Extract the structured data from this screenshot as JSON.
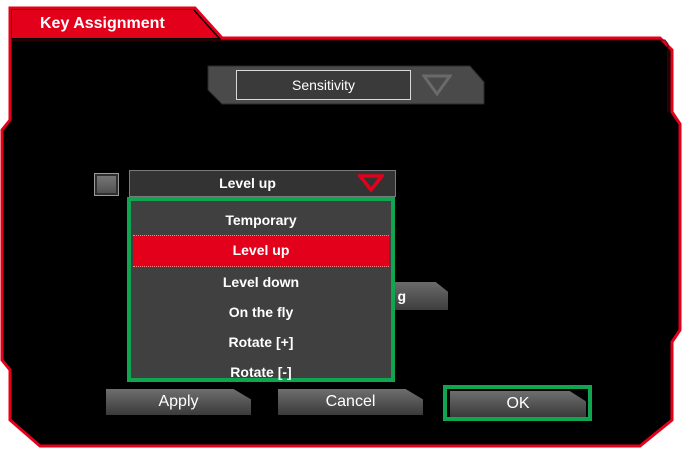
{
  "window": {
    "title": "Key Assignment"
  },
  "mode_selector": {
    "value": "Sensitivity"
  },
  "function_select": {
    "value": "Level up",
    "checkbox_checked": false
  },
  "dropdown": {
    "options": [
      "Temporary",
      "Level up",
      "Level down",
      "On the fly",
      "Rotate [+]",
      "Rotate [-]"
    ],
    "selected_index": 1
  },
  "hidden_button": {
    "visible_text": "g"
  },
  "buttons": {
    "apply": "Apply",
    "cancel": "Cancel",
    "ok": "OK"
  },
  "colors": {
    "accent_red": "#e3001b",
    "highlight_green": "#10a550",
    "panel_black": "#000000"
  }
}
